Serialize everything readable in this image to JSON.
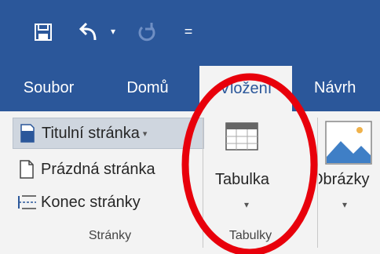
{
  "quick_access": {
    "save_icon": "save-icon",
    "undo_icon": "undo-icon",
    "undo_dropdown": "▾",
    "redo_icon": "redo-icon",
    "customize": "="
  },
  "tabs": [
    {
      "label": "Soubor"
    },
    {
      "label": "Domů"
    },
    {
      "label": "Vložení"
    },
    {
      "label": "Návrh"
    }
  ],
  "ribbon": {
    "pages": {
      "cover_page": "Titulní stránka",
      "blank_page": "Prázdná stránka",
      "page_break": "Konec stránky",
      "group_label": "Stránky"
    },
    "tables": {
      "table_button": "Tabulka",
      "group_label": "Tabulky"
    },
    "pictures": {
      "pictures_button": "Obrázky"
    }
  },
  "colors": {
    "ribbon_blue": "#2b579a",
    "ribbon_bg": "#f3f3f3",
    "annotation_red": "#e8000b"
  }
}
